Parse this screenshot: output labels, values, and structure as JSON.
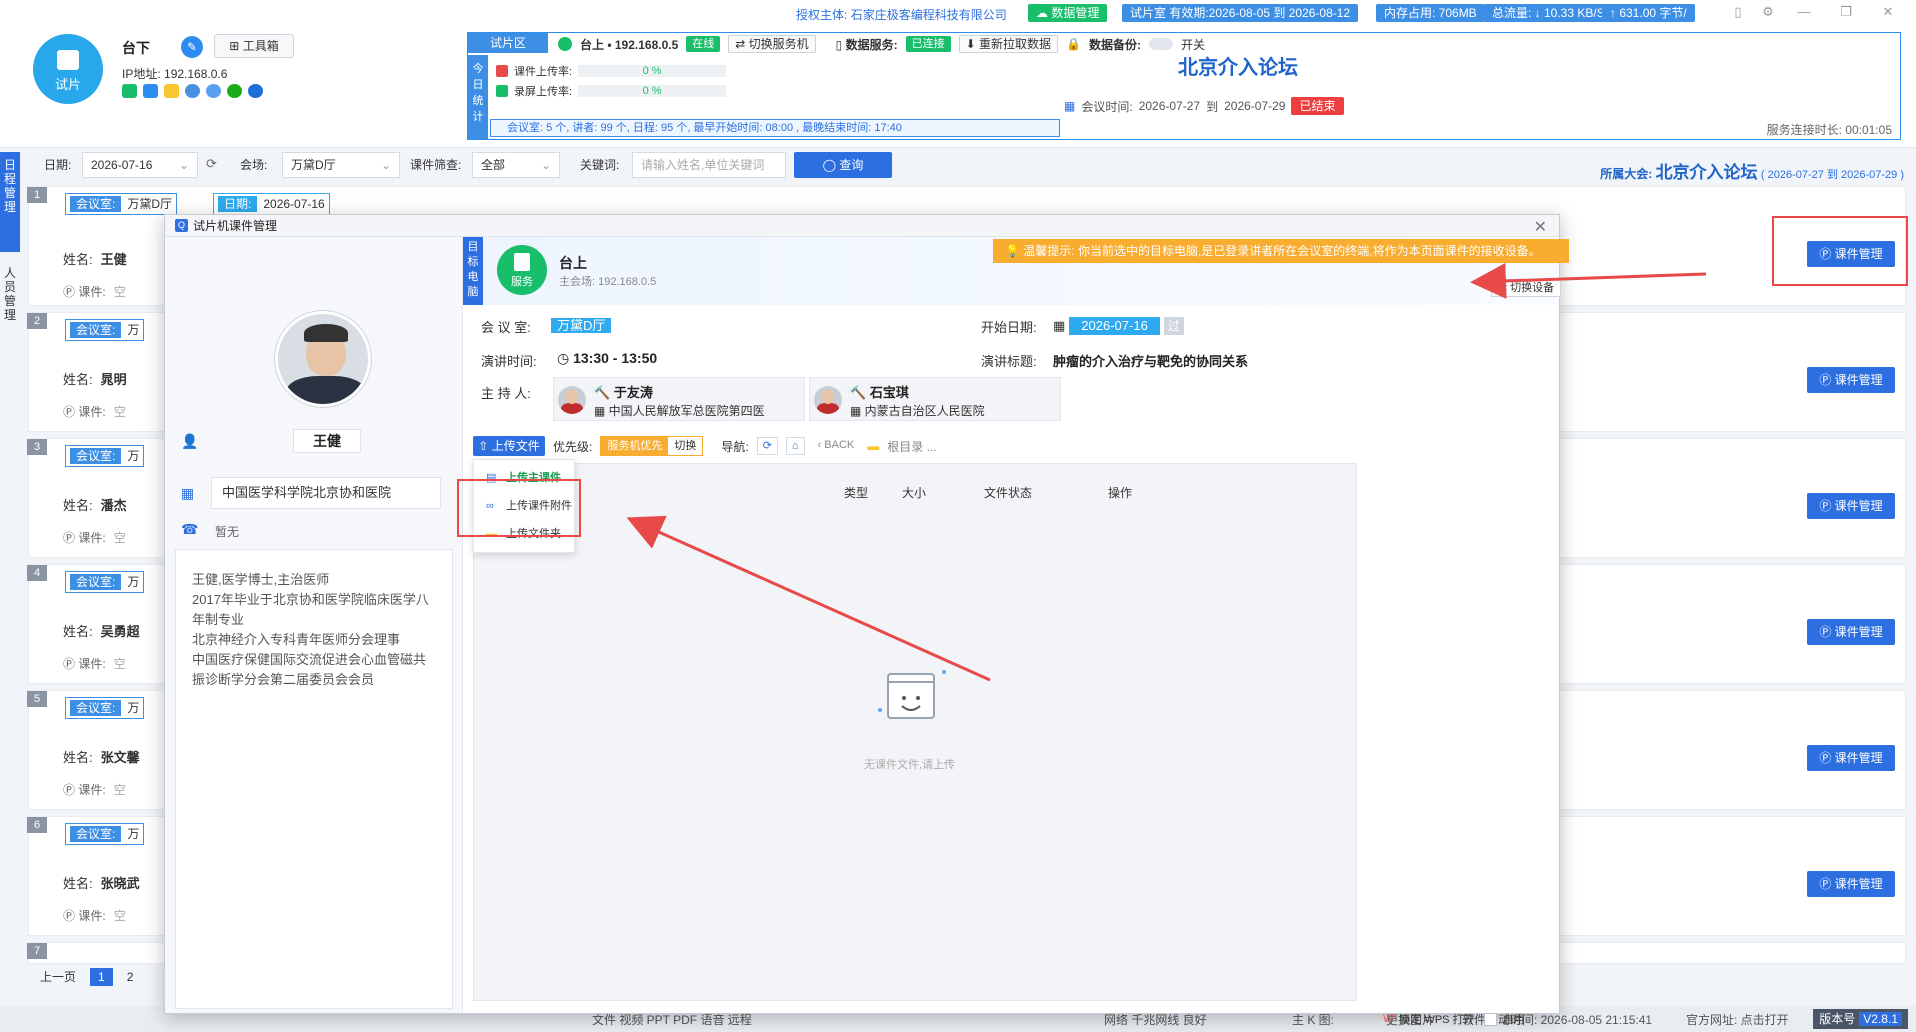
{
  "device": {
    "logo_label": "试片",
    "name": "台下",
    "toolbox_label": "工具箱",
    "ip_label": "IP地址:",
    "ip": "192.168.0.6"
  },
  "topbar": {
    "auth_label": "授权主体:",
    "auth_entity": "石家庄极客编程科技有限公司",
    "data_mgmt": "数据管理",
    "validity": "试片室 有效期:2026-08-05 到 2026-08-12",
    "memory": "内存占用: 706MB",
    "traffic": "总流量: ↓ 10.33 KB/S",
    "upload_rate": "↑ 631.00 字节/"
  },
  "panel": {
    "tab": "试片区",
    "host_label": "台上 • 192.168.0.5",
    "online": "在线",
    "switch_server": "切换服务机",
    "data_service_label": "数据服务:",
    "connected": "已连接",
    "refetch": "重新拉取数据",
    "backup_label": "数据备份:",
    "backup_switch": "开关",
    "stats_vertical": "今日统计",
    "upload_rate_label": "课件上传率:",
    "upload_rate_value": "0 %",
    "record_rate_label": "录屏上传率:",
    "record_rate_value": "0 %",
    "stats_line": "会议室: 5 个,   讲者: 99 个,   日程: 95 个,   最早开始时间: 08:00 ,     最晚结束时间: 17:40",
    "conf_title": "北京介入论坛",
    "conf_time_label": "会议时间:",
    "conf_start": "2026-07-27",
    "conf_to": "到",
    "conf_end": "2026-07-29",
    "ended": "已结束",
    "uptime": "服务连接时长: 00:01:05"
  },
  "filters": {
    "date_label": "日期:",
    "date_value": "2026-07-16",
    "venue_label": "会场:",
    "venue_value": "万黛D厅",
    "course_filter_label": "课件筛查:",
    "course_filter_value": "全部",
    "keyword_label": "关键词:",
    "keyword_placeholder": "请输入姓名,单位关键词",
    "query_btn": "查询",
    "belong_label": "所属大会:",
    "belong_name": "北京介入论坛",
    "belong_range": "( 2026-07-27 到 2026-07-29 )"
  },
  "left_nav": {
    "schedule": "日程管理",
    "people": "人员管理"
  },
  "schedule": {
    "room_key": "会议室:",
    "room_value": "万黛D厅",
    "date_key": "日期:",
    "date_value": "2026-07-16",
    "name_label": "姓名:",
    "course_label": "课件:",
    "empty": "空",
    "manage_btn": "课件管理",
    "rows": [
      {
        "num": "1",
        "room": "万黛D厅",
        "name": "王健"
      },
      {
        "num": "2",
        "room": "万",
        "name": "晁明"
      },
      {
        "num": "3",
        "room": "万",
        "name": "潘杰"
      },
      {
        "num": "4",
        "room": "万",
        "name": "吴勇超"
      },
      {
        "num": "5",
        "room": "万",
        "name": "张文馨"
      },
      {
        "num": "6",
        "room": "万",
        "name": "张晓武"
      },
      {
        "num": "7",
        "room": "",
        "name": ""
      }
    ],
    "pager": {
      "prev": "上一页",
      "p1": "1",
      "p2": "2"
    }
  },
  "statusbar": {
    "items": "文件   视频   PPT   PDF   语音   远程",
    "network": "网络   千兆网线   良好",
    "k_label": "主 K 图:",
    "change_image": "更换图片",
    "start_time": "软件启动时间: 2026-08-05 21:15:41",
    "website": "官方网址:   点击打开",
    "version_label": "版本号",
    "version": "V2.8.1"
  },
  "modal": {
    "title": "试片机课件管理",
    "speaker_name": "王健",
    "org": "中国医学科学院北京协和医院",
    "phone": "暂无",
    "bio": "王健,医学博士,主治医师\n2017年毕业于北京协和医学院临床医学八年制专业\n北京神经介入专科青年医师分会理事\n中国医疗保健国际交流促进会心血管磁共振诊断学分会第二届委员会会员",
    "target_vertical": "目标电脑",
    "server_label": "服务",
    "target_name": "台上",
    "target_ip": "主会场: 192.168.0.5",
    "tip": "温馨提示: 你当前选中的目标电脑,是已登录讲者所在会议室的终端,将作为本页面课件的接收设备。",
    "switch_device": "切换设备",
    "room_label": "会 议 室:",
    "room_value": "万黛D厅",
    "start_date_label": "开始日期:",
    "start_date_value": "2026-07-16",
    "past": "过",
    "talk_time_label": "演讲时间:",
    "talk_time_value": "13:30 - 13:50",
    "talk_title_label": "演讲标题:",
    "talk_title_value": "肿瘤的介入治疗与靶免的协同关系",
    "host_label": "主 持 人:",
    "hosts": [
      {
        "name": "于友涛",
        "org": "中国人民解放军总医院第四医"
      },
      {
        "name": "石宝琪",
        "org": "内蒙古自治区人民医院"
      }
    ],
    "upload_btn": "上传文件",
    "priority_label": "优先级:",
    "priority_on": "服务机优先",
    "priority_switch": "切换",
    "nav_label": "导航:",
    "back": "BACK",
    "root": "根目录 ...",
    "columns": [
      "类型",
      "大小",
      "文件状态",
      "操作"
    ],
    "empty_text": "无课件文件,请上传",
    "menu": [
      "上传主课件",
      "上传课件附件",
      "上传文件夹"
    ],
    "wps_label": "锁定 WPS 打开:",
    "wps_enable": "启用"
  }
}
